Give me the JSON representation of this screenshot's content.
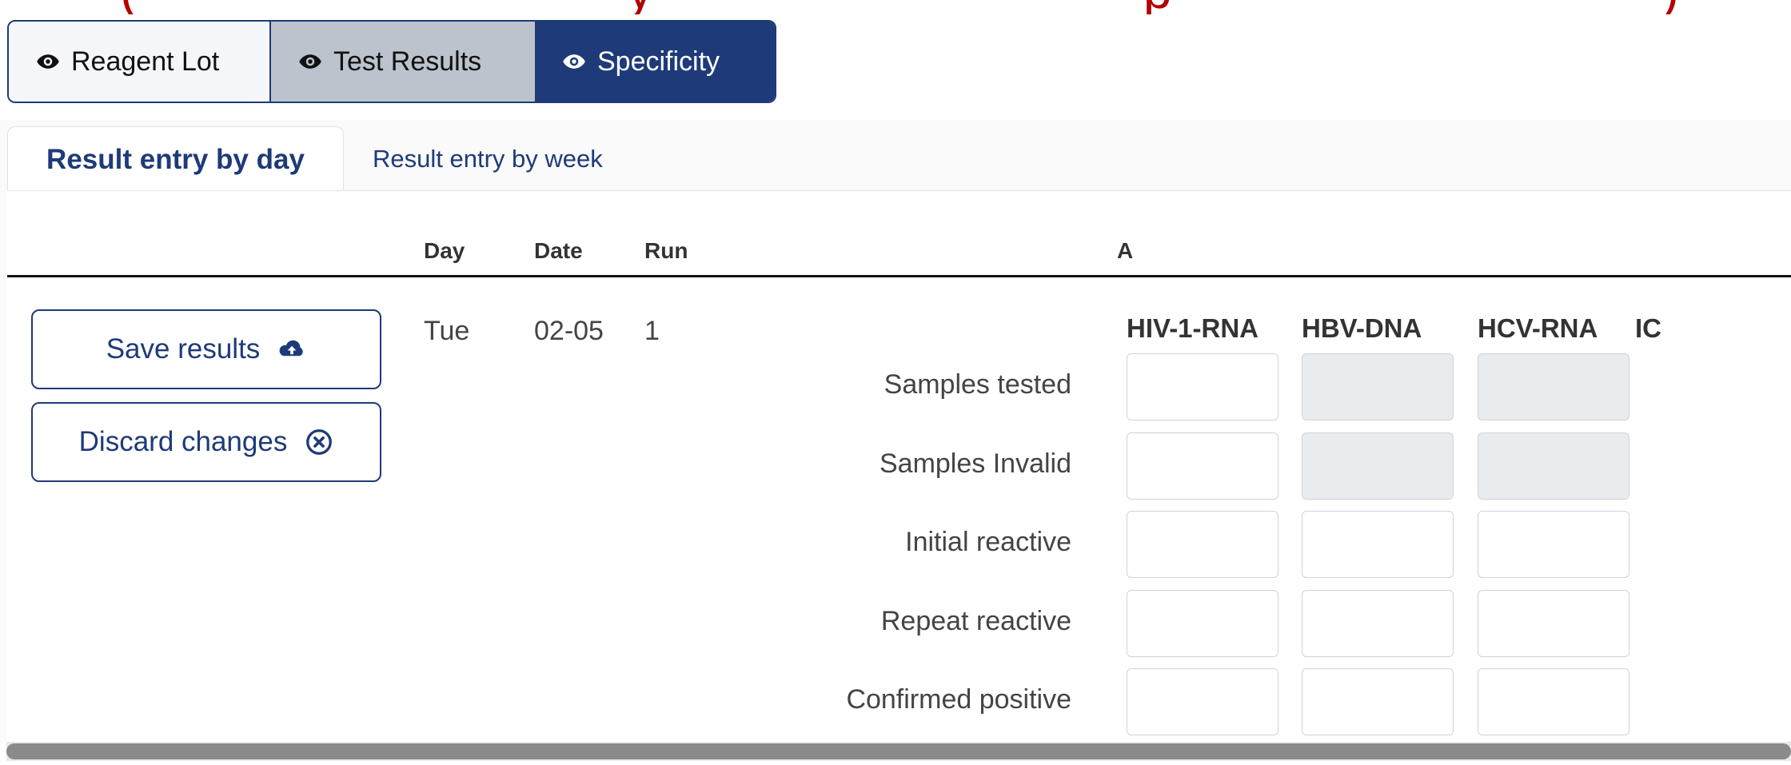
{
  "banner": {
    "fragments": [
      "(",
      "y",
      "p",
      ")"
    ]
  },
  "view_buttons": {
    "reagent_lot": "Reagent Lot",
    "test_results": "Test Results",
    "specificity": "Specificity"
  },
  "tabs": {
    "by_day": "Result entry by day",
    "by_week": "Result entry by week"
  },
  "table_header": {
    "day": "Day",
    "date": "Date",
    "run": "Run",
    "group": "A"
  },
  "actions": {
    "save": "Save results",
    "discard": "Discard changes"
  },
  "run": {
    "day": "Tue",
    "date": "02-05",
    "run": "1"
  },
  "columns": [
    "HIV-1-RNA",
    "HBV-DNA",
    "HCV-RNA",
    "IC"
  ],
  "rows": [
    {
      "label": "Samples tested"
    },
    {
      "label": "Samples Invalid"
    },
    {
      "label": "Initial reactive"
    },
    {
      "label": "Repeat reactive"
    },
    {
      "label": "Confirmed positive"
    }
  ],
  "colors": {
    "primary": "#1e3a78",
    "banner": "#b30000",
    "disabled_input": "#e9ecef"
  }
}
